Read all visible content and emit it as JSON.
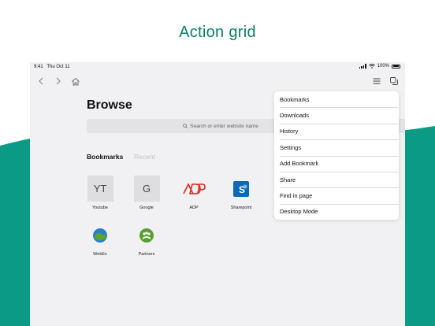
{
  "headline": "Action grid",
  "status_bar": {
    "time": "9:41",
    "date": "Thu Oct 11",
    "battery": "100%"
  },
  "browse": {
    "title": "Browse",
    "search_placeholder": "Search or enter website name",
    "segments": {
      "bookmarks": "Bookmarks",
      "recent": "Recent"
    }
  },
  "tiles": [
    {
      "label": "Youtube",
      "glyph": "YT"
    },
    {
      "label": "Google",
      "glyph": "G"
    },
    {
      "label": "ADP"
    },
    {
      "label": "Sharepoint"
    },
    {
      "label": "WebEx"
    },
    {
      "label": "Partners"
    }
  ],
  "menu": {
    "items": [
      "Bookmarks",
      "Downloads",
      "History",
      "Settings",
      "Add Bookmark",
      "Share",
      "Find in page",
      "Desktop Mode"
    ]
  },
  "colors": {
    "accent": "#0a7f6e",
    "wave": "#0a9a85",
    "device_bg": "#f1f1f3",
    "adp_red": "#e1261c",
    "sharepoint_blue": "#0b6ab7",
    "partners_green": "#5a9e2f"
  }
}
